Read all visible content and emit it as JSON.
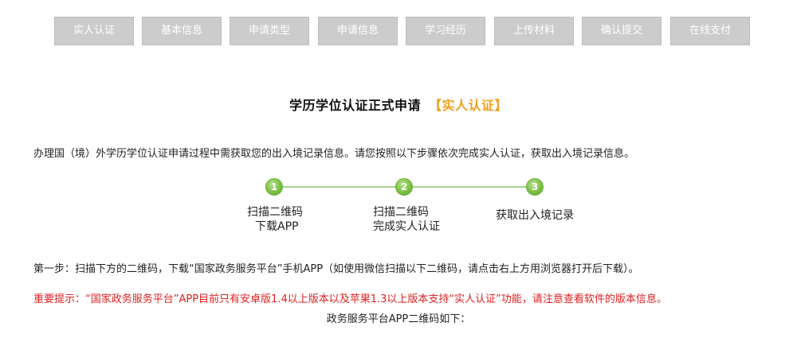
{
  "tabs": [
    {
      "label": "实人认证"
    },
    {
      "label": "基本信息"
    },
    {
      "label": "申请类型"
    },
    {
      "label": "申请信息"
    },
    {
      "label": "学习经历"
    },
    {
      "label": "上传材料"
    },
    {
      "label": "确认提交"
    },
    {
      "label": "在线支付"
    }
  ],
  "title": {
    "main": "学历学位认证正式申请",
    "highlight": "【实人认证】"
  },
  "intro_text": "办理国（境）外学历学位认证申请过程中需获取您的出入境记录信息。请您按照以下步骤依次完成实人认证，获取出入境记录信息。",
  "steps": [
    {
      "number": "1",
      "line1": "扫描二维码",
      "line2": "下载APP"
    },
    {
      "number": "2",
      "line1": "扫描二维码",
      "line2": "完成实人认证"
    },
    {
      "number": "3",
      "line1": "获取出入境记录",
      "line2": ""
    }
  ],
  "step1_text": "第一步：扫描下方的二维码，下载“国家政务服务平台”手机APP（如使用微信扫描以下二维码，请点击右上方用浏览器打开后下载）。",
  "notice_text": "重要提示：“国家政务服务平台”APP目前只有安卓版1.4以上版本以及苹果1.3以上版本支持“实人认证”功能，请注意查看软件的版本信息。",
  "qr_caption": "政务服务平台APP二维码如下：",
  "colors": {
    "tab_bg": "#cccccc",
    "highlight": "#f0a020",
    "step_green": "#7cc043",
    "notice_red": "#e02020"
  }
}
